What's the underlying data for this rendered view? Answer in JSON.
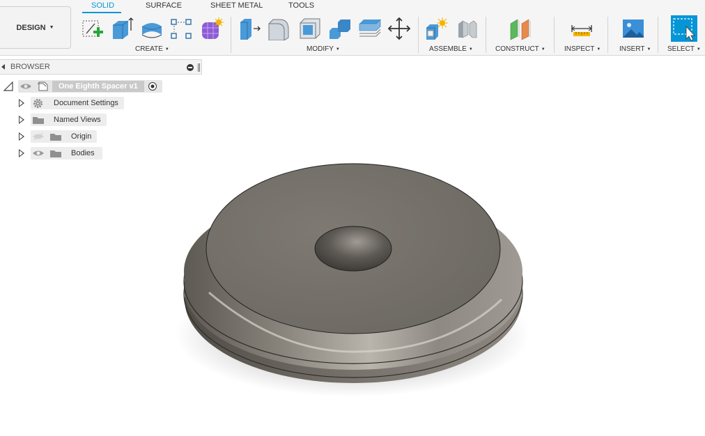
{
  "toolbar": {
    "workspace_button": "DESIGN",
    "tabs": [
      "SOLID",
      "SURFACE",
      "SHEET METAL",
      "TOOLS"
    ],
    "groups": {
      "create": "CREATE",
      "modify": "MODIFY",
      "assemble": "ASSEMBLE",
      "construct": "CONSTRUCT",
      "inspect": "INSPECT",
      "insert": "INSERT",
      "select": "SELECT"
    },
    "tools": [
      "create-sketch-icon",
      "extrude-icon",
      "revolve-icon",
      "sketch-pattern-icon",
      "form-icon",
      "press-pull-icon",
      "fillet-icon",
      "shell-icon",
      "combine-icon",
      "offset-face-icon",
      "move-icon",
      "new-component-icon",
      "joint-icon",
      "offset-plane-icon",
      "measure-icon",
      "insert-image-icon",
      "select-icon"
    ],
    "accent_color": "#0696d7"
  },
  "browser": {
    "title": "BROWSER",
    "root": "One Eighth Spacer v1",
    "items": [
      {
        "label": "Document Settings",
        "icon": "gear-icon"
      },
      {
        "label": "Named Views",
        "icon": "folder-icon"
      },
      {
        "label": "Origin",
        "icon": "folder-icon",
        "visibility": "hidden"
      },
      {
        "label": "Bodies",
        "icon": "folder-icon",
        "visibility": "visible"
      }
    ]
  },
  "viewport": {
    "model": "spacer-washer",
    "body_color": "#7a7670"
  }
}
